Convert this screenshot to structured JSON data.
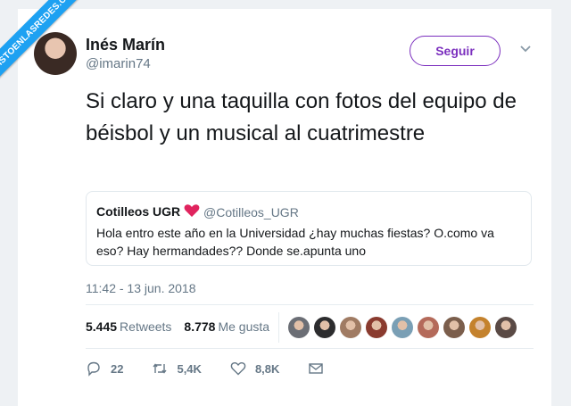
{
  "watermark": {
    "text": "VISTOENLASREDES.COM"
  },
  "author": {
    "name": "Inés Marín",
    "handle": "@imarin74"
  },
  "follow_label": "Seguir",
  "tweet": {
    "text": "Si claro y una taquilla con fotos del equipo de béisbol y un musical al cuatrimestre"
  },
  "quote": {
    "name": "Cotilleos UGR",
    "handle": "@Cotilleos_UGR",
    "text": "Hola entro este año en la Universidad ¿hay muchas fiestas? O.como va eso? Hay hermandades?? Donde se.apunta uno"
  },
  "timestamp": "11:42 - 13 jun. 2018",
  "stats": {
    "retweets_count": "5.445",
    "retweets_label": "Retweets",
    "likes_count": "8.778",
    "likes_label": "Me gusta"
  },
  "actions": {
    "replies": "22",
    "retweets": "5,4K",
    "likes": "8,8K"
  },
  "colors": {
    "follow": "#7b2fbe",
    "heart": "#e0245e",
    "ribbon": "#1da1f2",
    "muted": "#657786"
  },
  "liker_avatar_colors": [
    "#6b6e75",
    "#2c2c2e",
    "#a07b63",
    "#8a3b2f",
    "#7a9fb5",
    "#b46a5a",
    "#7b5e4c",
    "#c4822d",
    "#5a4a45"
  ]
}
